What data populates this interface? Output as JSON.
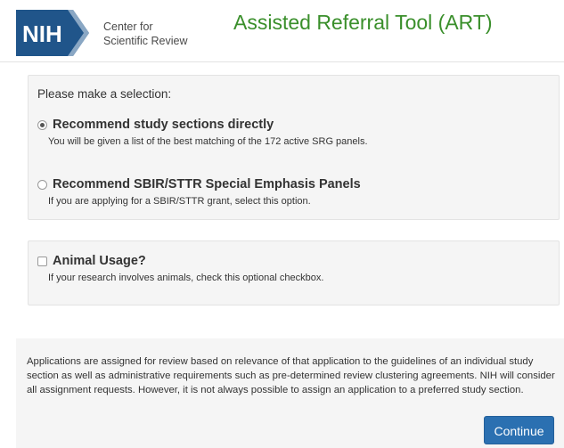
{
  "header": {
    "logo_text": "NIH",
    "logo_subtitle_line1": "Center for",
    "logo_subtitle_line2": "Scientific Review",
    "title": "Assisted Referral Tool (ART)",
    "title_color": "#3a8f2b",
    "logo_primary_color": "#20558a"
  },
  "selection": {
    "prompt": "Please make a selection:",
    "options": [
      {
        "label": "Recommend study sections directly",
        "description": "You will be given a list of the best matching of the 172 active SRG panels.",
        "selected": true
      },
      {
        "label": "Recommend SBIR/STTR Special Emphasis Panels",
        "description": "If you are applying for a SBIR/STTR grant, select this option.",
        "selected": false
      }
    ]
  },
  "animal": {
    "label": "Animal Usage?",
    "description": "If your research involves animals, check this optional checkbox.",
    "checked": false
  },
  "footer": {
    "disclaimer": "Applications are assigned for review based on relevance of that application to the guidelines of an individual study section as well as administrative requirements such as pre-determined review clustering agreements. NIH will consider all assignment requests. However, it is not always possible to assign an application to a preferred study section.",
    "continue_label": "Continue",
    "button_color": "#2b70b1"
  }
}
